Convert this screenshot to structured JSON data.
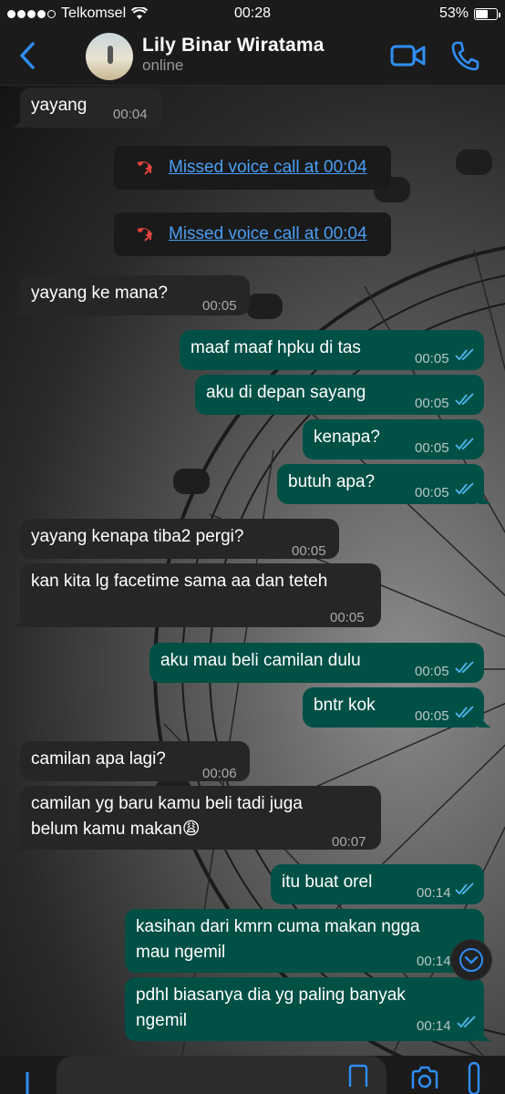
{
  "status_bar": {
    "carrier": "Telkomsel",
    "time": "00:28",
    "battery": "53%",
    "battery_level": 0.53
  },
  "header": {
    "contact_name": "Lily Binar Wiratama",
    "contact_status": "online",
    "icons": [
      "back-chevron-icon",
      "avatar",
      "video-camera-icon",
      "phone-icon"
    ]
  },
  "messages": [
    {
      "dir": "in",
      "text": "yayang",
      "time": "00:04"
    },
    {
      "dir": "missed",
      "text": "Missed voice call at 00:04"
    },
    {
      "dir": "missed",
      "text": "Missed voice call at 00:04"
    },
    {
      "dir": "in",
      "text": "yayang ke mana?",
      "time": "00:05"
    },
    {
      "dir": "out",
      "text": "maaf maaf hpku di tas",
      "time": "00:05"
    },
    {
      "dir": "out",
      "text": "aku di depan sayang",
      "time": "00:05"
    },
    {
      "dir": "out",
      "text": "kenapa?",
      "time": "00:05"
    },
    {
      "dir": "out",
      "text": "butuh apa?",
      "time": "00:05"
    },
    {
      "dir": "in",
      "text": "yayang kenapa tiba2 pergi?",
      "time": "00:05"
    },
    {
      "dir": "in",
      "text": "kan kita lg facetime sama aa dan teteh",
      "time": "00:05"
    },
    {
      "dir": "out",
      "text": "aku mau beli camilan dulu",
      "time": "00:05"
    },
    {
      "dir": "out",
      "text": "bntr kok",
      "time": "00:05"
    },
    {
      "dir": "in",
      "text": "camilan apa lagi?",
      "time": "00:06"
    },
    {
      "dir": "in",
      "text": "camilan yg baru kamu beli tadi juga belum kamu makan😩",
      "line1": "camilan yg baru kamu beli tadi juga",
      "line2": "belum kamu makan😩",
      "time": "00:07"
    },
    {
      "dir": "out",
      "text": "itu buat orel",
      "time": "00:14"
    },
    {
      "dir": "out",
      "text": "kasihan dari kmrn cuma makan ngga mau ngemil",
      "line1": "kasihan dari kmrn cuma makan ngga",
      "line2": "mau ngemil",
      "time": "00:14"
    },
    {
      "dir": "out",
      "text": "pdhl biasanya dia yg paling banyak ngemil",
      "line1": "pdhl biasanya dia yg paling banyak",
      "line2": "ngemil",
      "time": "00:14"
    }
  ],
  "colors": {
    "incoming_bubble": "#262626",
    "outgoing_bubble": "#005046",
    "accent_blue": "#2f8ef4",
    "missed_call_red": "#e0443c",
    "read_ticks": "#4fb8f0"
  }
}
